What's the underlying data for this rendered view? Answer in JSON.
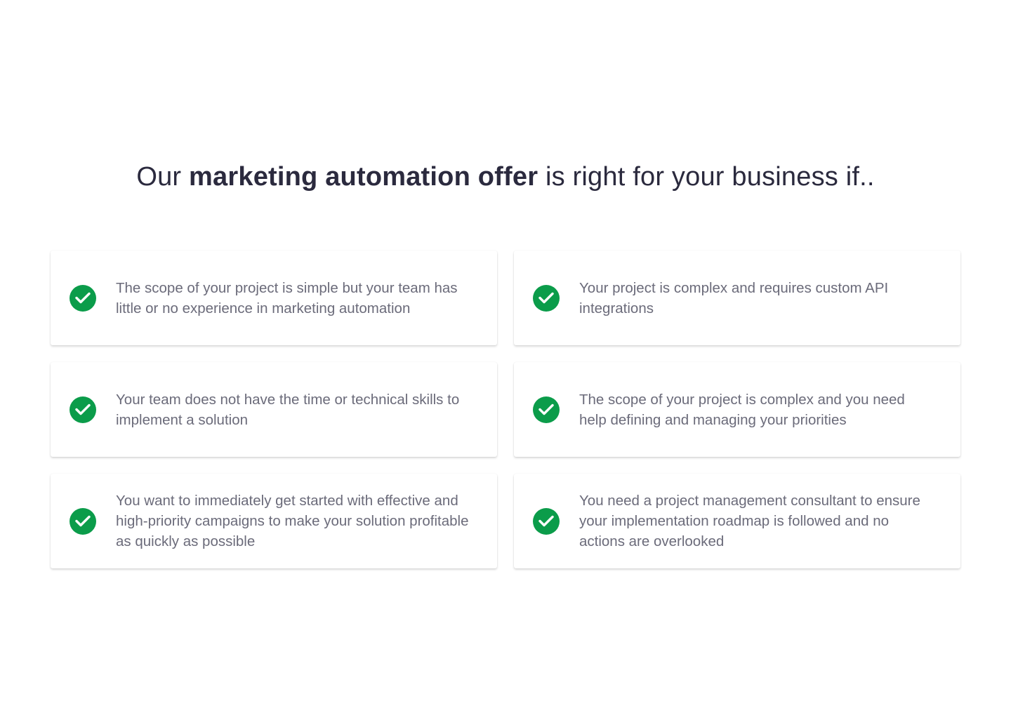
{
  "headline": {
    "prefix": "Our ",
    "emphasis": "marketing automation offer",
    "suffix": " is right for your business if.."
  },
  "cards": [
    {
      "icon": "check-circle-icon",
      "text": "The scope of your project is simple but your team has little or no experience in marketing automation"
    },
    {
      "icon": "check-circle-icon",
      "text": "Your project is complex and requires custom API integrations"
    },
    {
      "icon": "check-circle-icon",
      "text": "Your team does not have the time or technical skills to implement a solution"
    },
    {
      "icon": "check-circle-icon",
      "text": "The scope of your project is complex and you need help defining and managing your priorities"
    },
    {
      "icon": "check-circle-icon",
      "text": "You want to immediately get started with effective and high-priority campaigns to make your solution profitable as quickly as possible"
    },
    {
      "icon": "check-circle-icon",
      "text": "You need a project management consultant to ensure your implementation roadmap is followed and no actions are overlooked"
    }
  ],
  "colors": {
    "check_green": "#0b9c4a",
    "heading": "#2b2a3e",
    "body_text": "#6b6b7a",
    "background": "#ffffff"
  }
}
